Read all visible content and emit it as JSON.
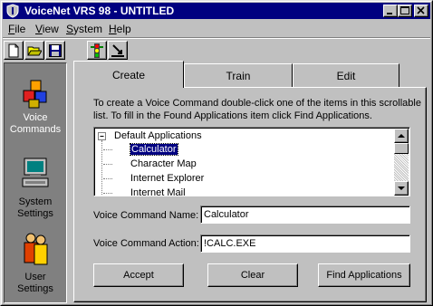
{
  "window": {
    "title": "VoiceNet VRS 98 - UNTITLED"
  },
  "titlebar_buttons": {
    "minimize": "minimize",
    "maximize": "maximize",
    "close": "close"
  },
  "menu": [
    {
      "label": "File",
      "accel": "F",
      "rest": "ile"
    },
    {
      "label": "View",
      "accel": "V",
      "rest": "iew"
    },
    {
      "label": "System",
      "accel": "S",
      "rest": "ystem"
    },
    {
      "label": "Help",
      "accel": "H",
      "rest": "elp"
    }
  ],
  "toolbar": {
    "icons": [
      "new-document-icon",
      "open-folder-icon",
      "save-disk-icon",
      "traffic-light-icon",
      "down-arrow-tool-icon"
    ]
  },
  "sidebar": {
    "items": [
      {
        "label": "Voice\nCommands",
        "line1": "Voice",
        "line2": "Commands",
        "icon": "blocks-icon"
      },
      {
        "label": "System\nSettings",
        "line1": "System",
        "line2": "Settings",
        "icon": "computer-icon"
      },
      {
        "label": "User\nSettings",
        "line1": "User",
        "line2": "Settings",
        "icon": "users-icon"
      }
    ]
  },
  "tabs": [
    {
      "label": "Create",
      "active": true
    },
    {
      "label": "Train",
      "active": false
    },
    {
      "label": "Edit",
      "active": false
    }
  ],
  "instructions": "To create a Voice Command double-click one of the items in this scrollable list. To fill in the Found Applications item click Find Applications.",
  "tree": {
    "root": "Default Applications",
    "expander": "−",
    "items": [
      "Calculator",
      "Character Map",
      "Internet Explorer",
      "Internet Mail"
    ],
    "selected": "Calculator"
  },
  "form": {
    "name_label": "Voice Command Name:",
    "name_value": "Calculator",
    "action_label": "Voice Command Action:",
    "action_value": "!CALC.EXE"
  },
  "buttons": {
    "accept": "Accept",
    "clear": "Clear",
    "find": "Find Applications"
  },
  "colors": {
    "titlebar": "#000080",
    "face": "#c0c0c0",
    "selection": "#000080"
  }
}
